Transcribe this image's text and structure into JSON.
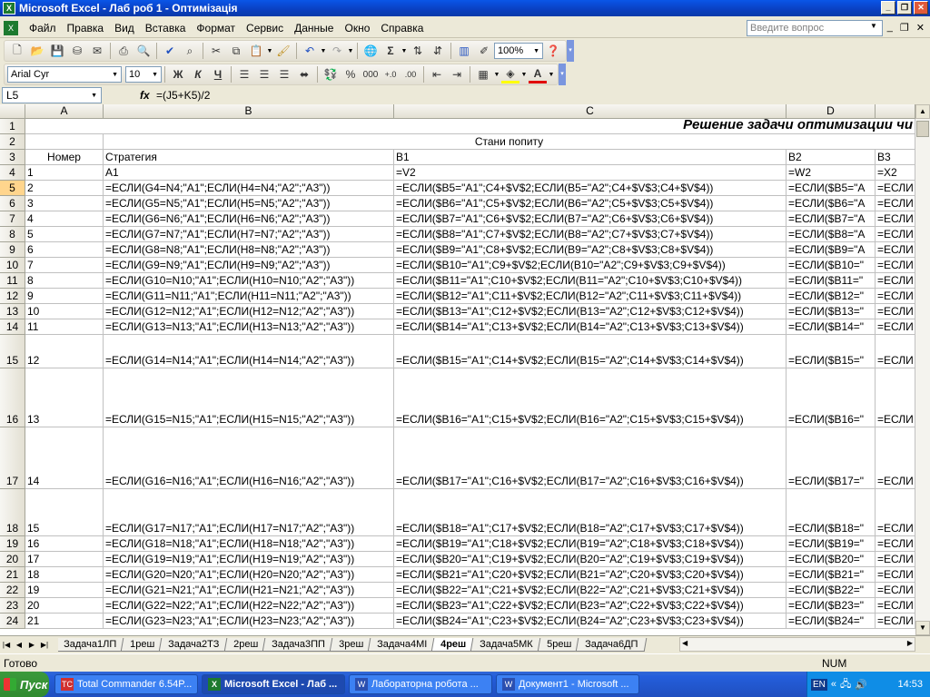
{
  "window": {
    "title": "Microsoft Excel - Лаб роб 1 - Оптимізація"
  },
  "menu": [
    "Файл",
    "Правка",
    "Вид",
    "Вставка",
    "Формат",
    "Сервис",
    "Данные",
    "Окно",
    "Справка"
  ],
  "ask": {
    "placeholder": "Введите вопрос"
  },
  "toolbar": {
    "zoom": "100%",
    "font": "Arial Cyr",
    "size": "10",
    "bold": "Ж",
    "italic": "К",
    "underline": "Ч",
    "percent": "%",
    "thousands": "000"
  },
  "formula_bar": {
    "name_box": "L5",
    "fx": "fx",
    "formula": "=(J5+K5)/2"
  },
  "columns": [
    "A",
    "B",
    "C",
    "D"
  ],
  "rows": [
    {
      "n": "1",
      "a": "",
      "b": "",
      "c": "",
      "d": "",
      "e": ""
    },
    {
      "n": "2",
      "a": "",
      "b": "",
      "c": "",
      "d": "",
      "e": ""
    },
    {
      "n": "3",
      "a": "Номер",
      "b": "Стратегия",
      "c": "B1",
      "d": "B2",
      "e": "B3"
    },
    {
      "n": "4",
      "a": "1",
      "b": "A1",
      "c": "=V2",
      "d": "=W2",
      "e": "=X2"
    },
    {
      "n": "5",
      "a": "2",
      "b": "=ЕСЛИ(G4=N4;\"A1\";ЕСЛИ(H4=N4;\"A2\";\"A3\"))",
      "c": "=ЕСЛИ($B5=\"A1\";C4+$V$2;ЕСЛИ(B5=\"A2\";C4+$V$3;C4+$V$4))",
      "d": "=ЕСЛИ($B5=\"A",
      "e": "=ЕСЛИ"
    },
    {
      "n": "6",
      "a": "3",
      "b": "=ЕСЛИ(G5=N5;\"A1\";ЕСЛИ(H5=N5;\"A2\";\"A3\"))",
      "c": "=ЕСЛИ($B6=\"A1\";C5+$V$2;ЕСЛИ(B6=\"A2\";C5+$V$3;C5+$V$4))",
      "d": "=ЕСЛИ($B6=\"A",
      "e": "=ЕСЛИ"
    },
    {
      "n": "7",
      "a": "4",
      "b": "=ЕСЛИ(G6=N6;\"A1\";ЕСЛИ(H6=N6;\"A2\";\"A3\"))",
      "c": "=ЕСЛИ($B7=\"A1\";C6+$V$2;ЕСЛИ(B7=\"A2\";C6+$V$3;C6+$V$4))",
      "d": "=ЕСЛИ($B7=\"A",
      "e": "=ЕСЛИ"
    },
    {
      "n": "8",
      "a": "5",
      "b": "=ЕСЛИ(G7=N7;\"A1\";ЕСЛИ(H7=N7;\"A2\";\"A3\"))",
      "c": "=ЕСЛИ($B8=\"A1\";C7+$V$2;ЕСЛИ(B8=\"A2\";C7+$V$3;C7+$V$4))",
      "d": "=ЕСЛИ($B8=\"A",
      "e": "=ЕСЛИ"
    },
    {
      "n": "9",
      "a": "6",
      "b": "=ЕСЛИ(G8=N8;\"A1\";ЕСЛИ(H8=N8;\"A2\";\"A3\"))",
      "c": "=ЕСЛИ($B9=\"A1\";C8+$V$2;ЕСЛИ(B9=\"A2\";C8+$V$3;C8+$V$4))",
      "d": "=ЕСЛИ($B9=\"A",
      "e": "=ЕСЛИ"
    },
    {
      "n": "10",
      "a": "7",
      "b": "=ЕСЛИ(G9=N9;\"A1\";ЕСЛИ(H9=N9;\"A2\";\"A3\"))",
      "c": "=ЕСЛИ($B10=\"A1\";C9+$V$2;ЕСЛИ(B10=\"A2\";C9+$V$3;C9+$V$4))",
      "d": "=ЕСЛИ($B10=\"",
      "e": "=ЕСЛИ"
    },
    {
      "n": "11",
      "a": "8",
      "b": "=ЕСЛИ(G10=N10;\"A1\";ЕСЛИ(H10=N10;\"A2\";\"A3\"))",
      "c": "=ЕСЛИ($B11=\"A1\";C10+$V$2;ЕСЛИ(B11=\"A2\";C10+$V$3;C10+$V$4))",
      "d": "=ЕСЛИ($B11=\"",
      "e": "=ЕСЛИ"
    },
    {
      "n": "12",
      "a": "9",
      "b": "=ЕСЛИ(G11=N11;\"A1\";ЕСЛИ(H11=N11;\"A2\";\"A3\"))",
      "c": "=ЕСЛИ($B12=\"A1\";C11+$V$2;ЕСЛИ(B12=\"A2\";C11+$V$3;C11+$V$4))",
      "d": "=ЕСЛИ($B12=\"",
      "e": "=ЕСЛИ"
    },
    {
      "n": "13",
      "a": "10",
      "b": "=ЕСЛИ(G12=N12;\"A1\";ЕСЛИ(H12=N12;\"A2\";\"A3\"))",
      "c": "=ЕСЛИ($B13=\"A1\";C12+$V$2;ЕСЛИ(B13=\"A2\";C12+$V$3;C12+$V$4))",
      "d": "=ЕСЛИ($B13=\"",
      "e": "=ЕСЛИ"
    },
    {
      "n": "14",
      "a": "11",
      "b": "=ЕСЛИ(G13=N13;\"A1\";ЕСЛИ(H13=N13;\"A2\";\"A3\"))",
      "c": "=ЕСЛИ($B14=\"A1\";C13+$V$2;ЕСЛИ(B14=\"A2\";C13+$V$3;C13+$V$4))",
      "d": "=ЕСЛИ($B14=\"",
      "e": "=ЕСЛИ"
    },
    {
      "n": "15",
      "a": "12",
      "b": "=ЕСЛИ(G14=N14;\"A1\";ЕСЛИ(H14=N14;\"A2\";\"A3\"))",
      "c": "=ЕСЛИ($B15=\"A1\";C14+$V$2;ЕСЛИ(B15=\"A2\";C14+$V$3;C14+$V$4))",
      "d": "=ЕСЛИ($B15=\"",
      "e": "=ЕСЛИ"
    },
    {
      "n": "16",
      "a": "13",
      "b": "=ЕСЛИ(G15=N15;\"A1\";ЕСЛИ(H15=N15;\"A2\";\"A3\"))",
      "c": "=ЕСЛИ($B16=\"A1\";C15+$V$2;ЕСЛИ(B16=\"A2\";C15+$V$3;C15+$V$4))",
      "d": "=ЕСЛИ($B16=\"",
      "e": "=ЕСЛИ"
    },
    {
      "n": "17",
      "a": "14",
      "b": "=ЕСЛИ(G16=N16;\"A1\";ЕСЛИ(H16=N16;\"A2\";\"A3\"))",
      "c": "=ЕСЛИ($B17=\"A1\";C16+$V$2;ЕСЛИ(B17=\"A2\";C16+$V$3;C16+$V$4))",
      "d": "=ЕСЛИ($B17=\"",
      "e": "=ЕСЛИ"
    },
    {
      "n": "18",
      "a": "15",
      "b": "=ЕСЛИ(G17=N17;\"A1\";ЕСЛИ(H17=N17;\"A2\";\"A3\"))",
      "c": "=ЕСЛИ($B18=\"A1\";C17+$V$2;ЕСЛИ(B18=\"A2\";C17+$V$3;C17+$V$4))",
      "d": "=ЕСЛИ($B18=\"",
      "e": "=ЕСЛИ"
    },
    {
      "n": "19",
      "a": "16",
      "b": "=ЕСЛИ(G18=N18;\"A1\";ЕСЛИ(H18=N18;\"A2\";\"A3\"))",
      "c": "=ЕСЛИ($B19=\"A1\";C18+$V$2;ЕСЛИ(B19=\"A2\";C18+$V$3;C18+$V$4))",
      "d": "=ЕСЛИ($B19=\"",
      "e": "=ЕСЛИ"
    },
    {
      "n": "20",
      "a": "17",
      "b": "=ЕСЛИ(G19=N19;\"A1\";ЕСЛИ(H19=N19;\"A2\";\"A3\"))",
      "c": "=ЕСЛИ($B20=\"A1\";C19+$V$2;ЕСЛИ(B20=\"A2\";C19+$V$3;C19+$V$4))",
      "d": "=ЕСЛИ($B20=\"",
      "e": "=ЕСЛИ"
    },
    {
      "n": "21",
      "a": "18",
      "b": "=ЕСЛИ(G20=N20;\"A1\";ЕСЛИ(H20=N20;\"A2\";\"A3\"))",
      "c": "=ЕСЛИ($B21=\"A1\";C20+$V$2;ЕСЛИ(B21=\"A2\";C20+$V$3;C20+$V$4))",
      "d": "=ЕСЛИ($B21=\"",
      "e": "=ЕСЛИ"
    },
    {
      "n": "22",
      "a": "19",
      "b": "=ЕСЛИ(G21=N21;\"A1\";ЕСЛИ(H21=N21;\"A2\";\"A3\"))",
      "c": "=ЕСЛИ($B22=\"A1\";C21+$V$2;ЕСЛИ(B22=\"A2\";C21+$V$3;C21+$V$4))",
      "d": "=ЕСЛИ($B22=\"",
      "e": "=ЕСЛИ"
    },
    {
      "n": "23",
      "a": "20",
      "b": "=ЕСЛИ(G22=N22;\"A1\";ЕСЛИ(H22=N22;\"A2\";\"A3\"))",
      "c": "=ЕСЛИ($B23=\"A1\";C22+$V$2;ЕСЛИ(B23=\"A2\";C22+$V$3;C22+$V$4))",
      "d": "=ЕСЛИ($B23=\"",
      "e": "=ЕСЛИ"
    },
    {
      "n": "24",
      "a": "21",
      "b": "=ЕСЛИ(G23=N23;\"A1\";ЕСЛИ(H23=N23;\"A2\";\"A3\"))",
      "c": "=ЕСЛИ($B24=\"A1\";C23+$V$2;ЕСЛИ(B24=\"A2\";C23+$V$3;C23+$V$4))",
      "d": "=ЕСЛИ($B24=\"",
      "e": "=ЕСЛИ"
    }
  ],
  "title_cell": "Решение задачи оптимизации чи",
  "demand_header": "Стани попиту",
  "sheets": [
    "Задача1ЛП",
    "1реш",
    "Задача2ТЗ",
    "2реш",
    "Задача3ПП",
    "3реш",
    "Задача4МІ",
    "4реш",
    "Задача5МК",
    "5реш",
    "Задача6ДП"
  ],
  "active_sheet": "4реш",
  "status": {
    "left": "Готово",
    "num": "NUM"
  },
  "taskbar": {
    "start": "Пуск",
    "tasks": [
      "Total Commander 6.54P...",
      "Microsoft Excel - Лаб ...",
      "Лабораторна робота ...",
      "Документ1 - Microsoft ..."
    ],
    "lang": "EN",
    "clock": "14:53"
  }
}
